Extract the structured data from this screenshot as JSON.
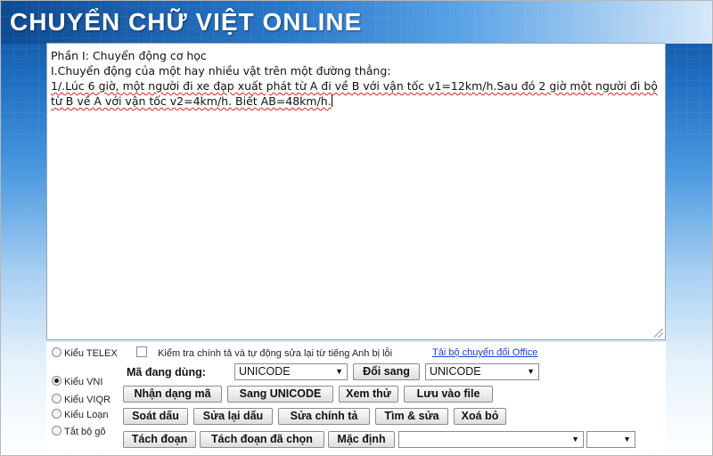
{
  "header": {
    "title": "CHUYỂN CHỮ VIỆT ONLINE"
  },
  "editor": {
    "line1": "Phần I: Chuyển động cơ học",
    "line2": "I.Chuyển động của một hay nhiều vật trên một đường thẳng:",
    "line3": "1/.Lúc 6 giờ, một người đi xe đạp xuất phát từ A đi về B với vận tốc v1=12km/h.Sau đó 2 giờ một người đi bộ từ B về A với vận tốc v2=4km/h. Biết AB=48km/h."
  },
  "options": {
    "typing_modes": [
      {
        "label": "Kiểu TELEX",
        "selected": false
      },
      {
        "label": "Kiểu VNI",
        "selected": true
      },
      {
        "label": "Kiểu VIQR",
        "selected": false
      },
      {
        "label": "Kiểu Loạn",
        "selected": false
      },
      {
        "label": "Tắt bộ gõ",
        "selected": false
      }
    ],
    "spellcheck_label": "Kiểm tra chính tả và tự động sửa lại từ tiếng Anh bị lỗi",
    "spellcheck_checked": false,
    "office_link": "Tải bộ chuyển đổi Office"
  },
  "encoding": {
    "label": "Mã đang dùng:",
    "current": "UNICODE",
    "convert_button": "Đổi sang",
    "target": "UNICODE"
  },
  "buttons": {
    "detect": "Nhận dạng mã",
    "to_unicode": "Sang UNICODE",
    "preview": "Xem thử",
    "save_file": "Lưu vào file",
    "check_tone": "Soát dấu",
    "fix_tone": "Sửa lại dấu",
    "fix_spelling": "Sửa chính tả",
    "find_replace": "Tìm & sửa",
    "delete": "Xoá bỏ",
    "split_paragraph": "Tách đoạn",
    "split_selected": "Tách đoạn đã chọn",
    "default": "Mặc định"
  },
  "selects": {
    "extra1": "",
    "extra2": ""
  }
}
